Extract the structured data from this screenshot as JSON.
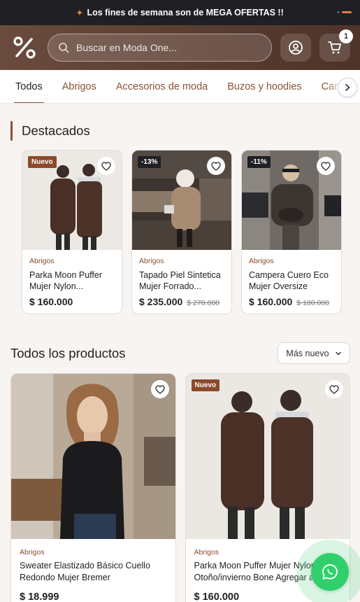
{
  "promo": {
    "icon": "sparkle-icon",
    "text": "Los fines de semana son de MEGA OFERTAS !!"
  },
  "header": {
    "logo_icon": "percent-icon",
    "search": {
      "placeholder": "Buscar en Moda One...",
      "icon": "search-icon"
    },
    "account_icon": "user-icon",
    "cart": {
      "icon": "cart-icon",
      "count": "1"
    }
  },
  "tabs": {
    "items": [
      {
        "label": "Todos"
      },
      {
        "label": "Abrigos"
      },
      {
        "label": "Accesorios de moda"
      },
      {
        "label": "Buzos y hoodies"
      },
      {
        "label": "Camperas"
      }
    ],
    "active": "Todos"
  },
  "featured": {
    "title": "Destacados",
    "items": [
      {
        "tag": "Nuevo",
        "category": "Abrigos",
        "name": "Parka Moon Puffer Mujer Nylon...",
        "price": "$ 160.000",
        "old_price": ""
      },
      {
        "tag": "-13%",
        "category": "Abrigos",
        "name": "Tapado Piel Sintetica Mujer Forrado...",
        "price": "$ 235.000",
        "old_price": "$ 270.000"
      },
      {
        "tag": "-11%",
        "category": "Abrigos",
        "name": "Campera Cuero Eco Mujer Oversize Cuell...",
        "price": "$ 160.000",
        "old_price": "$ 180.000"
      }
    ]
  },
  "products": {
    "title": "Todos los productos",
    "sort_label": "Más nuevo",
    "items": [
      {
        "tag": "",
        "category": "Abrigos",
        "name": "Sweater Elastizado Básico Cuello Redondo Mujer Bremer",
        "price": "$ 18.999"
      },
      {
        "tag": "Nuevo",
        "category": "Abrigos",
        "name": "Parka Moon Puffer Mujer Nylon Otoño/invierno Bone Agregar al",
        "price": "$ 160.000"
      }
    ]
  },
  "whatsapp": {
    "icon": "whatsapp-icon"
  },
  "colors": {
    "accent": "#8a4a2c",
    "header": "#5a3d31",
    "promo_bg": "#1f1f24",
    "whatsapp": "#2fd06b"
  }
}
